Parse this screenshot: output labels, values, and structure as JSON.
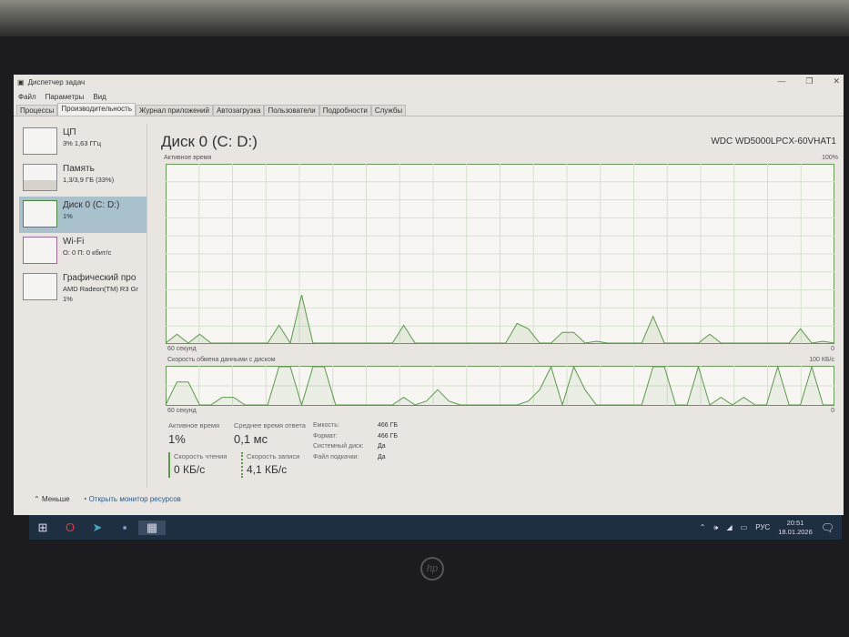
{
  "window": {
    "title": "Диспетчер задач",
    "min": "—",
    "max": "❐",
    "close": "✕"
  },
  "menu": [
    "Файл",
    "Параметры",
    "Вид"
  ],
  "tabs": [
    "Процессы",
    "Производительность",
    "Журнал приложений",
    "Автозагрузка",
    "Пользователи",
    "Подробности",
    "Службы"
  ],
  "active_tab": 1,
  "sidebar": [
    {
      "name": "ЦП",
      "sub": "3% 1,63 ГГц"
    },
    {
      "name": "Память",
      "sub": "1,3/3,9 ГБ (33%)"
    },
    {
      "name": "Диск 0 (C: D:)",
      "sub": "1%"
    },
    {
      "name": "Wi-Fi",
      "sub": "О: 0 П: 0 кбит/с"
    },
    {
      "name": "Графический про",
      "sub": "AMD Radeon(TM) R3 Gr",
      "sub2": "1%"
    }
  ],
  "main": {
    "title": "Диск 0 (C: D:)",
    "model": "WDC WD5000LPCX-60VHAT1",
    "g1_label": "Активное время",
    "g1_max": "100%",
    "g1_time": "60 секунд",
    "g1_min": "0",
    "g2_label": "Скорость обмена данными с диском",
    "g2_max": "100 КБ/с",
    "g2_time": "60 секунд",
    "g2_min": "0"
  },
  "stats": {
    "active_label": "Активное время",
    "active": "1%",
    "resp_label": "Среднее время ответа",
    "resp": "0,1 мс",
    "read_label": "Скорость чтения",
    "read": "0 КБ/с",
    "write_label": "Скорость записи",
    "write": "4,1 КБ/с",
    "props": [
      {
        "k": "Емкость:",
        "v": "466 ГБ"
      },
      {
        "k": "Формат:",
        "v": "466 ГБ"
      },
      {
        "k": "Системный диск:",
        "v": "Да"
      },
      {
        "k": "Файл подкачки:",
        "v": "Да"
      }
    ]
  },
  "footer": {
    "less": "Меньше",
    "monitor": "Открыть монитор ресурсов"
  },
  "taskbar": {
    "lang": "РУС",
    "time": "20:51",
    "date": "18.01.2026"
  },
  "chart_data": {
    "type": "line",
    "active_time": [
      0,
      5,
      0,
      5,
      0,
      0,
      0,
      0,
      0,
      0,
      10,
      0,
      27,
      0,
      0,
      0,
      0,
      0,
      0,
      0,
      0,
      10,
      0,
      0,
      0,
      0,
      0,
      0,
      0,
      0,
      0,
      11,
      8,
      0,
      0,
      6,
      6,
      0,
      1,
      0,
      0,
      0,
      0,
      15,
      0,
      0,
      0,
      0,
      5,
      0,
      0,
      0,
      0,
      0,
      0,
      0,
      8,
      0,
      1,
      0
    ],
    "transfer": [
      0,
      60,
      60,
      0,
      0,
      20,
      20,
      0,
      0,
      0,
      100,
      100,
      0,
      100,
      100,
      0,
      0,
      0,
      0,
      0,
      0,
      20,
      0,
      10,
      40,
      10,
      0,
      0,
      0,
      0,
      0,
      0,
      10,
      40,
      100,
      0,
      100,
      40,
      0,
      0,
      0,
      0,
      0,
      100,
      100,
      0,
      0,
      100,
      0,
      20,
      0,
      20,
      0,
      0,
      100,
      0,
      0,
      100,
      0,
      0
    ],
    "ylim_active": [
      0,
      100
    ],
    "ylim_transfer": [
      0,
      100
    ]
  }
}
